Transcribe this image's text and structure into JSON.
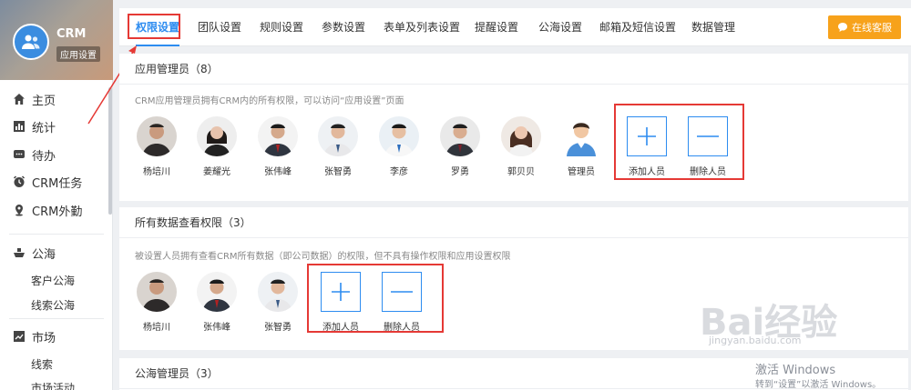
{
  "app": {
    "title": "CRM",
    "subtitle": "应用设置"
  },
  "sidebar": {
    "items": [
      {
        "label": "主页",
        "icon": "home-icon"
      },
      {
        "label": "统计",
        "icon": "bar-chart-icon"
      },
      {
        "label": "待办",
        "icon": "chat-icon"
      },
      {
        "label": "CRM任务",
        "icon": "clock-icon"
      },
      {
        "label": "CRM外勤",
        "icon": "location-pin-icon"
      },
      {
        "label": "公海",
        "icon": "ship-icon"
      },
      {
        "label": "市场",
        "icon": "trend-chart-icon"
      }
    ],
    "subitems": {
      "gonghai": [
        "客户公海",
        "线索公海"
      ],
      "shichang": [
        "线索",
        "市场活动"
      ]
    }
  },
  "tabs": [
    "权限设置",
    "团队设置",
    "规则设置",
    "参数设置",
    "表单及列表设置",
    "提醒设置",
    "公海设置",
    "邮箱及短信设置",
    "数据管理"
  ],
  "service_button": "在线客服",
  "panels": {
    "admins": {
      "title": "应用管理员（8）",
      "desc": "CRM应用管理员拥有CRM内的所有权限，可以访问“应用设置”页面",
      "people": [
        "杨培川",
        "姜耀光",
        "张伟峰",
        "张智勇",
        "李彦",
        "罗勇",
        "郭贝贝",
        "管理员"
      ],
      "add_label": "添加人员",
      "remove_label": "删除人员"
    },
    "viewers": {
      "title": "所有数据查看权限（3）",
      "desc": "被设置人员拥有查看CRM所有数据（即公司数据）的权限，但不具有操作权限和应用设置权限",
      "people": [
        "杨培川",
        "张伟峰",
        "张智勇"
      ],
      "add_label": "添加人员",
      "remove_label": "删除人员"
    },
    "pool_admins": {
      "title": "公海管理员（3）"
    }
  },
  "watermark": {
    "brand": "Bai经验",
    "url": "jingyan.baidu.com"
  },
  "windows_activation": {
    "title": "激活 Windows",
    "hint": "转到“设置”以激活 Windows。"
  },
  "colors": {
    "accent": "#2d8cf0",
    "service": "#f7a21b",
    "highlight": "#e53935"
  }
}
